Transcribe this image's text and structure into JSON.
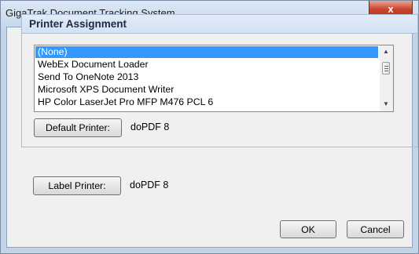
{
  "window": {
    "title": "GigaTrak Document Tracking System",
    "close_label": "x"
  },
  "group": {
    "title": "Printer Assignment"
  },
  "printer_list": {
    "items": [
      "(None)",
      "WebEx Document Loader",
      "Send To OneNote 2013",
      "Microsoft XPS Document Writer",
      "HP Color LaserJet Pro MFP M476 PCL 6"
    ],
    "selected_index": 0
  },
  "default_printer": {
    "button_label": "Default Printer:",
    "value": "doPDF 8"
  },
  "label_printer": {
    "button_label": "Label Printer:",
    "value": "doPDF 8"
  },
  "footer": {
    "ok_label": "OK",
    "cancel_label": "Cancel"
  }
}
